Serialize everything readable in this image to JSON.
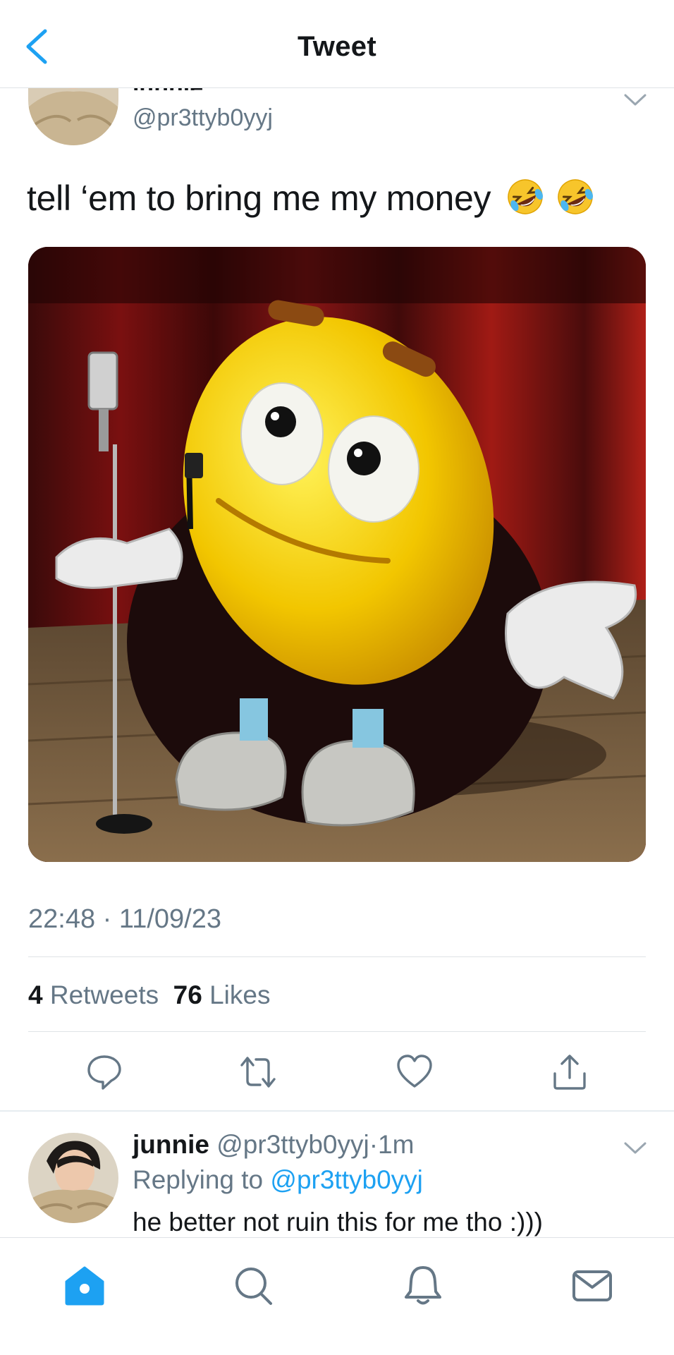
{
  "header": {
    "title": "Tweet"
  },
  "tweet": {
    "name_partial": "junnie",
    "handle": "@pr3ttyb0yyj",
    "text": "tell ‘em to bring me my money",
    "emoji": [
      "rolling-on-floor-laughing",
      "rolling-on-floor-laughing"
    ],
    "time": "22:48",
    "separator": "·",
    "date": "11/09/23",
    "retweets_count": "4",
    "retweets_label": "Retweets",
    "likes_count": "76",
    "likes_label": "Likes"
  },
  "actions": [
    "reply-icon",
    "retweet-icon",
    "like-icon",
    "share-icon"
  ],
  "reply": {
    "name": "junnie",
    "handle": "@pr3ttyb0yyj",
    "separator": "·",
    "age": "1m",
    "replying_prefix": "Replying to",
    "replying_handle": "@pr3ttyb0yyj",
    "text": "he better not ruin this for me tho :)))"
  },
  "tabbar": {
    "items": [
      "home-icon",
      "search-icon",
      "notifications-icon",
      "messages-icon"
    ],
    "active": "home-icon"
  },
  "colors": {
    "accent": "#1da1f2",
    "secondary_text": "#657786",
    "divider": "#dfe3e6"
  }
}
